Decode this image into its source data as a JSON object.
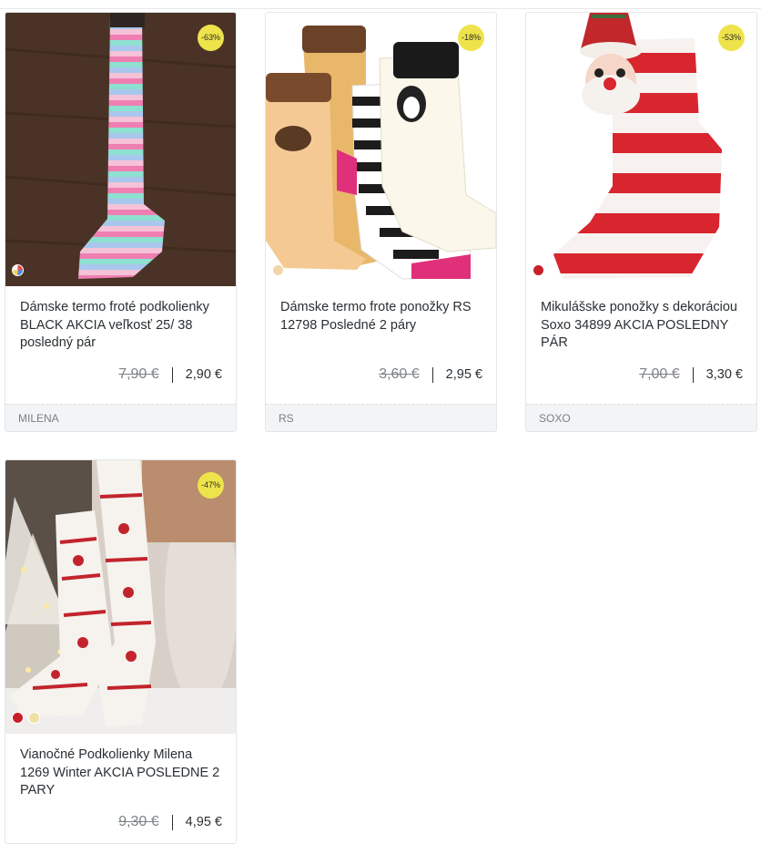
{
  "products": [
    {
      "title": "Dámske termo froté podkolienky BLACK AKCIA veľkosť 25/ 38 posledný pár",
      "old_price": "7,90 €",
      "new_price": "2,90 €",
      "discount": "-63%",
      "brand": "MILENA",
      "swatches": [
        "#d94a6a"
      ]
    },
    {
      "title": "Dámske termo frote ponožky RS 12798 Posledné 2 páry",
      "old_price": "3,60 €",
      "new_price": "2,95 €",
      "discount": "-18%",
      "brand": "RS",
      "swatches": [
        "#f1d7a8"
      ]
    },
    {
      "title": "Mikulášske ponožky s dekoráciou Soxo 34899 AKCIA POSLEDNY PÁR",
      "old_price": "7,00 €",
      "new_price": "3,30 €",
      "discount": "-53%",
      "brand": "SOXO",
      "swatches": [
        "#c8202a"
      ]
    },
    {
      "title": "Vianočné Podkolienky Milena 1269 Winter AKCIA POSLEDNE 2 PARY",
      "old_price": "9,30 €",
      "new_price": "4,95 €",
      "discount": "-47%",
      "brand": "",
      "swatches": [
        "#c8202a",
        "#efe0a4"
      ]
    }
  ]
}
